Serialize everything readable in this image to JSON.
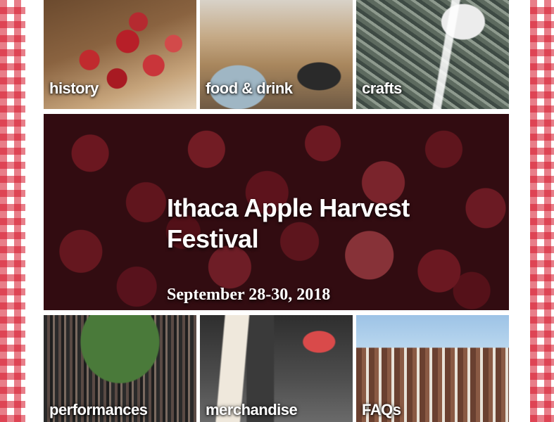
{
  "hero": {
    "title": "Ithaca Apple Harvest Festival",
    "date": "September 28-30, 2018"
  },
  "top_tiles": [
    {
      "label": "history"
    },
    {
      "label": "food & drink"
    },
    {
      "label": "crafts"
    }
  ],
  "bottom_tiles": [
    {
      "label": "performances"
    },
    {
      "label": "merchandise"
    },
    {
      "label": "FAQs"
    }
  ],
  "colors": {
    "gingham_red": "#d61428",
    "label_text": "#ffffff"
  }
}
